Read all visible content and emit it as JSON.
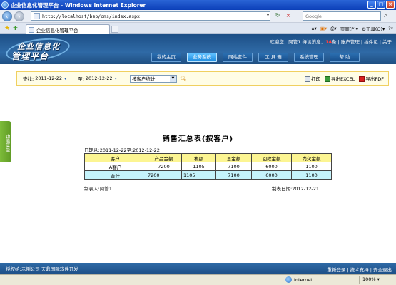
{
  "browser": {
    "window_title": "企业信息化管理平台 - Windows Internet Explorer",
    "url": "http://localhost/bsp/cms/index.aspx",
    "search_placeholder": "Google",
    "tab_title": "企业信息化管理平台",
    "cmd_page": "页面(P)",
    "cmd_tools": "工具(O)",
    "cmd_help": "?",
    "status_zone": "Internet",
    "status_zoom": "100%"
  },
  "header": {
    "logo_line1": "企业信息化",
    "logo_line2": "管理平台",
    "welcome_prefix": "欢迎您：阿管1 待读消息：",
    "unread_count": "14",
    "welcome_suffix": "条 | 账户管理 | 插件包 | 关于",
    "nav_tabs": [
      {
        "label": "我的主页",
        "active": false
      },
      {
        "label": "业务系统",
        "active": true
      },
      {
        "label": "网站套件",
        "active": false
      },
      {
        "label": "工 具 箱",
        "active": false
      },
      {
        "label": "系统管理",
        "active": false
      },
      {
        "label": "帮  助",
        "active": false
      }
    ]
  },
  "query": {
    "from_label": "查找:",
    "from_date": "2011-12-22",
    "to_label": "至:",
    "to_date": "2012-12-22",
    "report_type": "按客户统计",
    "print_label": "打印",
    "excel_label": "导出EXCEL",
    "pdf_label": "导出PDF"
  },
  "sidebar": {
    "label": "功能菜单"
  },
  "report": {
    "title": "销售汇总表(按客户)",
    "date_range": "日期从:2011-12-22至:2012-12-22",
    "headers": [
      "客户",
      "产品金额",
      "税额",
      "总金额",
      "回款金额",
      "尚欠金额"
    ],
    "rows": [
      [
        "A客户",
        "7200",
        "1105",
        "7100",
        "6000",
        "1100"
      ]
    ],
    "total": [
      "合计",
      "7200",
      "1105",
      "7100",
      "6000",
      "1100"
    ],
    "maker": "制表人:阿管1",
    "make_date": "制表日期:2012-12-21"
  },
  "footer": {
    "left": "授权给:示例公司  天鼎国际软件开发",
    "right": "重新登录 | 技术支持 | 安全退出"
  },
  "colors": {
    "header_blue": "#2f6aa6",
    "table_header_bg": "#fcf592",
    "total_row_bg": "#c5f3fb",
    "query_bg": "#fffde6",
    "sidetab_green": "#7dbc3a"
  }
}
